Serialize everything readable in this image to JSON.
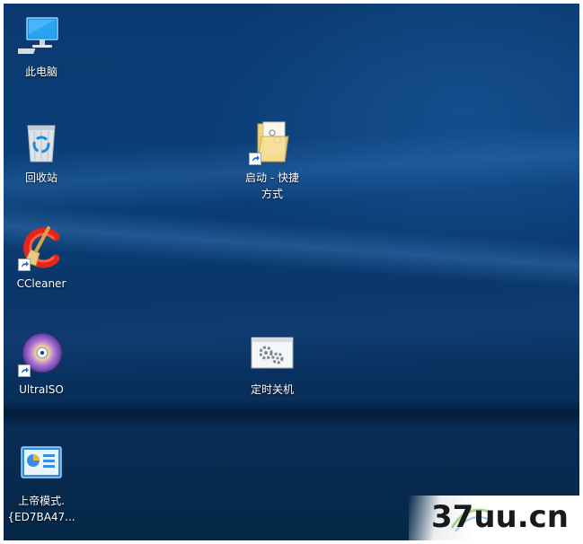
{
  "desktop": {
    "icons": [
      {
        "label": "此电脑",
        "icon": "computer-icon"
      },
      {
        "label": "回收站",
        "icon": "recycle-bin-icon"
      },
      {
        "label": "CCleaner",
        "icon": "ccleaner-icon",
        "shortcut": true
      },
      {
        "label": "UltraISO",
        "icon": "ultraiso-disc-icon",
        "shortcut": true
      },
      {
        "label_line1": "上帝模式.",
        "label_line2": "{ED7BA47...",
        "icon": "control-panel-icon"
      },
      {
        "label_line1": "启动 - 快捷",
        "label_line2": "方式",
        "icon": "startup-folder-icon",
        "shortcut": true
      },
      {
        "label": "定时关机",
        "icon": "settings-window-icon"
      }
    ]
  },
  "watermark": {
    "text": "37uu.cn"
  },
  "colors": {
    "desktop_top": "#0a3a70",
    "desktop_bottom": "#062746",
    "label_text": "#ffffff"
  }
}
